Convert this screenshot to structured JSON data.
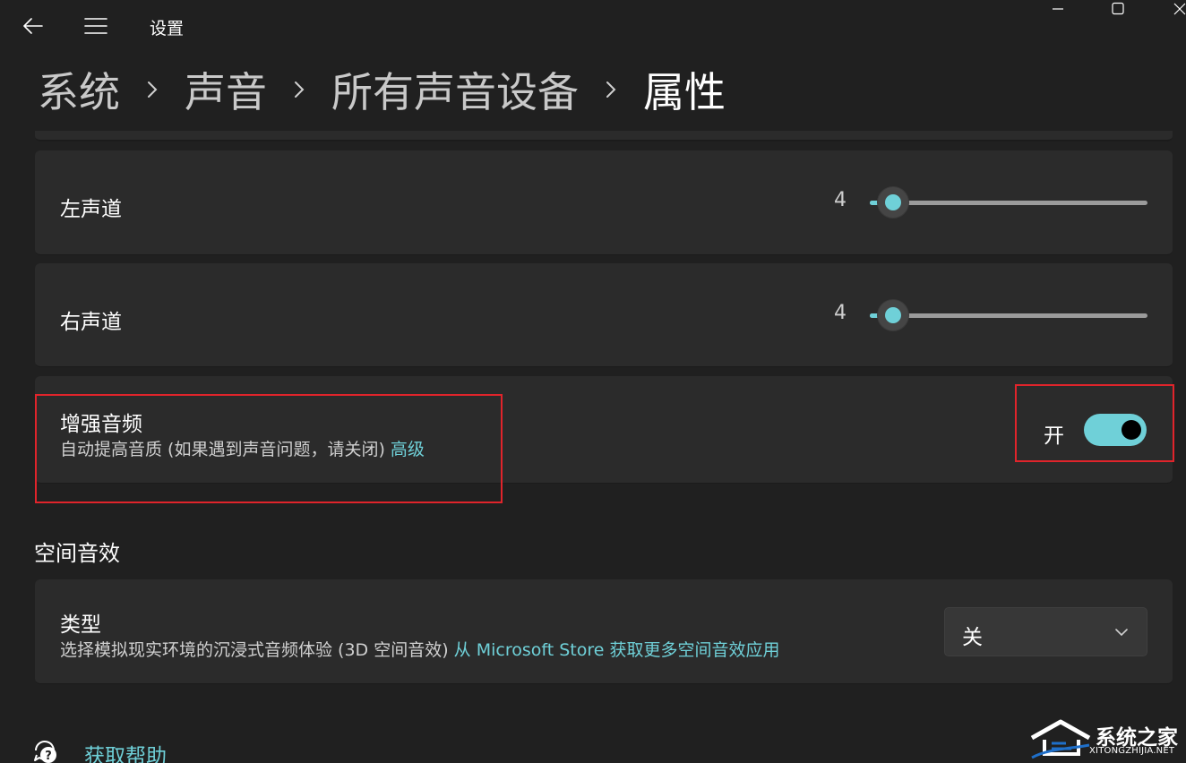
{
  "titlebar": {
    "back_icon": "back-arrow-icon",
    "menu_icon": "hamburger-menu-icon",
    "title": "设置"
  },
  "window_controls": {
    "minimize_icon": "minimize-icon",
    "maximize_icon": "maximize-icon",
    "close_icon": "close-icon"
  },
  "breadcrumb": {
    "items": [
      "系统",
      "声音",
      "所有声音设备",
      "属性"
    ],
    "separator_icon": "chevron-right-icon"
  },
  "balance": {
    "left": {
      "label": "左声道",
      "value": "4",
      "level_percent": 4
    },
    "right": {
      "label": "右声道",
      "value": "4",
      "level_percent": 4
    }
  },
  "enhance": {
    "title": "增强音频",
    "description": "自动提高音质 (如果遇到声音问题，请关闭)",
    "link": "高级",
    "toggle_state": "开",
    "toggle_on": true
  },
  "spatial": {
    "header": "空间音效",
    "type_title": "类型",
    "type_description": "选择模拟现实环境的沉浸式音频体验 (3D 空间音效)",
    "type_link": "从 Microsoft Store 获取更多空间音效应用",
    "dropdown_value": "关",
    "dropdown_icon": "chevron-down-icon"
  },
  "help": {
    "icon": "help-chat-icon",
    "label": "获取帮助"
  },
  "watermark": {
    "text": "系统之家",
    "url": "XITONGZHIJIA.NET",
    "icon": "house-logo-icon"
  },
  "colors": {
    "background": "#202020",
    "card": "#2b2b2b",
    "accent": "#6fd0d8",
    "highlight_border": "#e0242b"
  }
}
